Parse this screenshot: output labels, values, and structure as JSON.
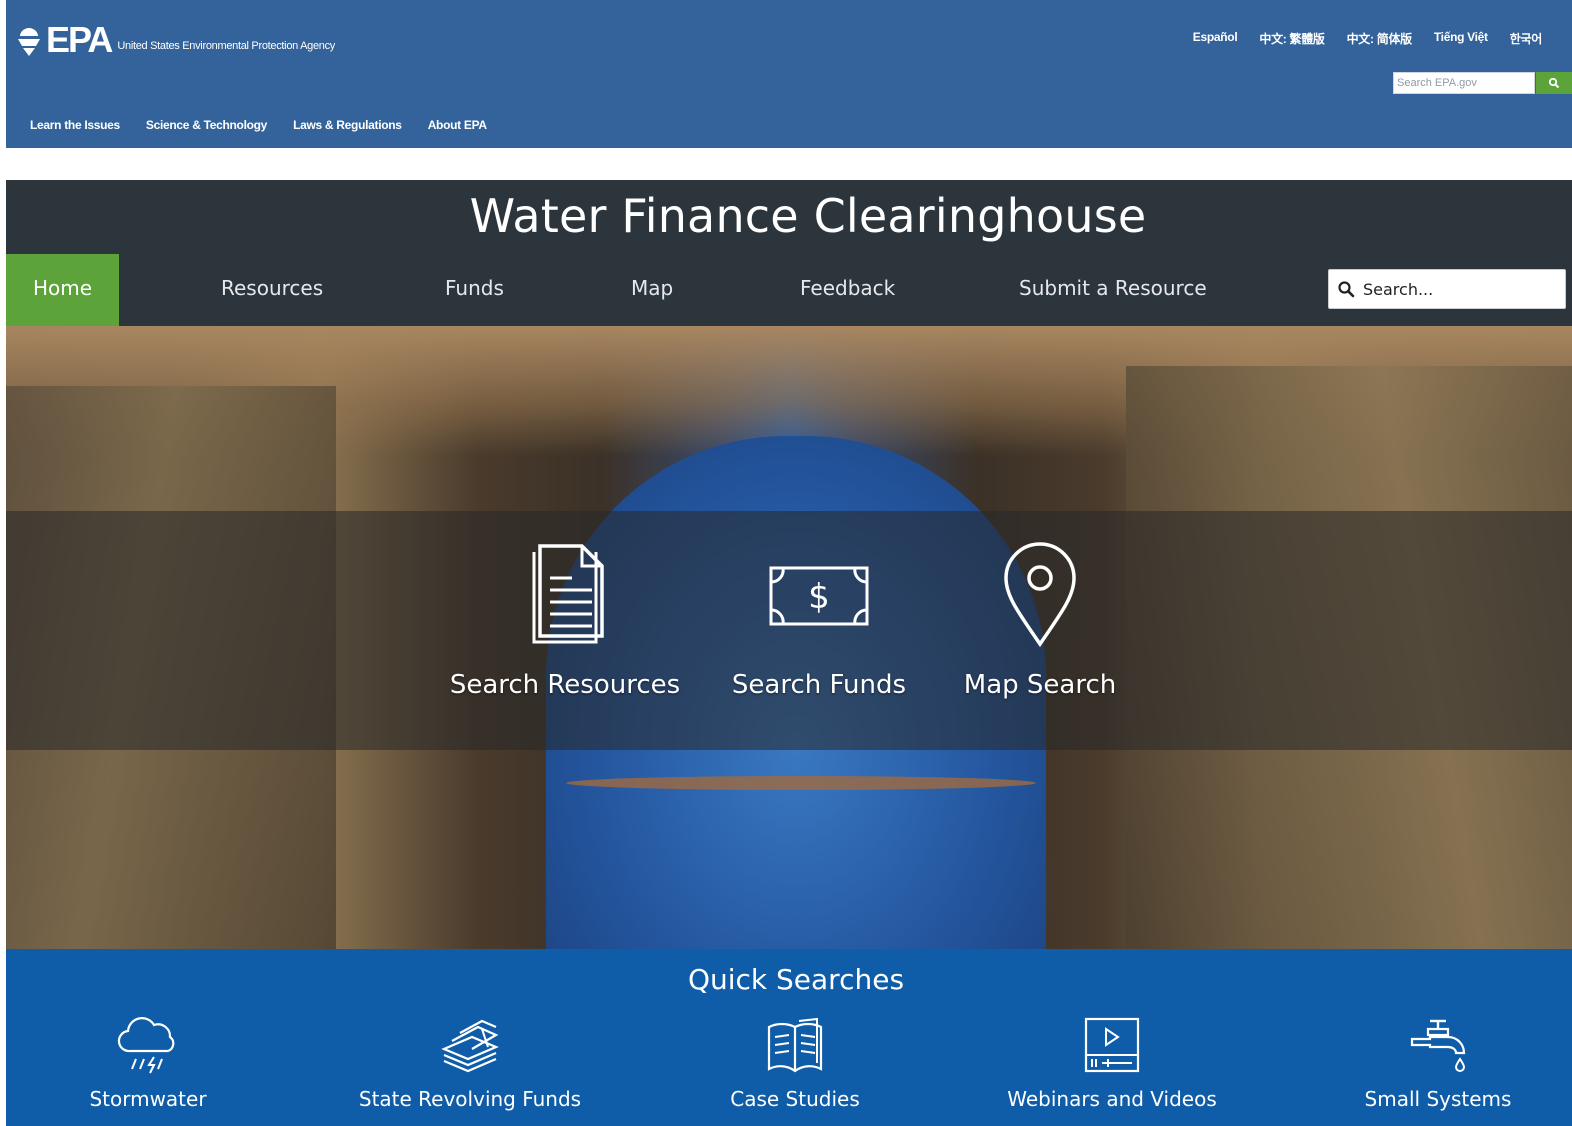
{
  "epa_header": {
    "logo_text": "EPA",
    "agency_name": "United States Environmental Protection Agency",
    "languages": [
      "Español",
      "中文: 繁體版",
      "中文: 简体版",
      "Tiếng Việt",
      "한국어"
    ],
    "search_placeholder": "Search EPA.gov",
    "nav": [
      "Learn the Issues",
      "Science & Technology",
      "Laws & Regulations",
      "About EPA"
    ]
  },
  "site": {
    "title": "Water Finance Clearinghouse",
    "nav": [
      "Home",
      "Resources",
      "Funds",
      "Map",
      "Feedback",
      "Submit a Resource"
    ],
    "active_nav": "Home",
    "search_placeholder": "Search..."
  },
  "hero": {
    "links": [
      {
        "label": "Search Resources",
        "icon": "document-icon"
      },
      {
        "label": "Search Funds",
        "icon": "dollar-bill-icon"
      },
      {
        "label": "Map Search",
        "icon": "map-pin-icon"
      }
    ]
  },
  "quick_searches": {
    "title": "Quick Searches",
    "items": [
      {
        "label": "Stormwater",
        "icon": "storm-cloud-icon"
      },
      {
        "label": "State Revolving Funds",
        "icon": "money-stack-icon"
      },
      {
        "label": "Case Studies",
        "icon": "book-icon"
      },
      {
        "label": "Webinars and Videos",
        "icon": "video-player-icon"
      },
      {
        "label": "Small Systems",
        "icon": "faucet-icon"
      }
    ]
  },
  "colors": {
    "epa_blue": "#33639a",
    "header_dark": "#2c343c",
    "accent_green": "#5ca33a",
    "quick_blue": "#0f5da8"
  }
}
